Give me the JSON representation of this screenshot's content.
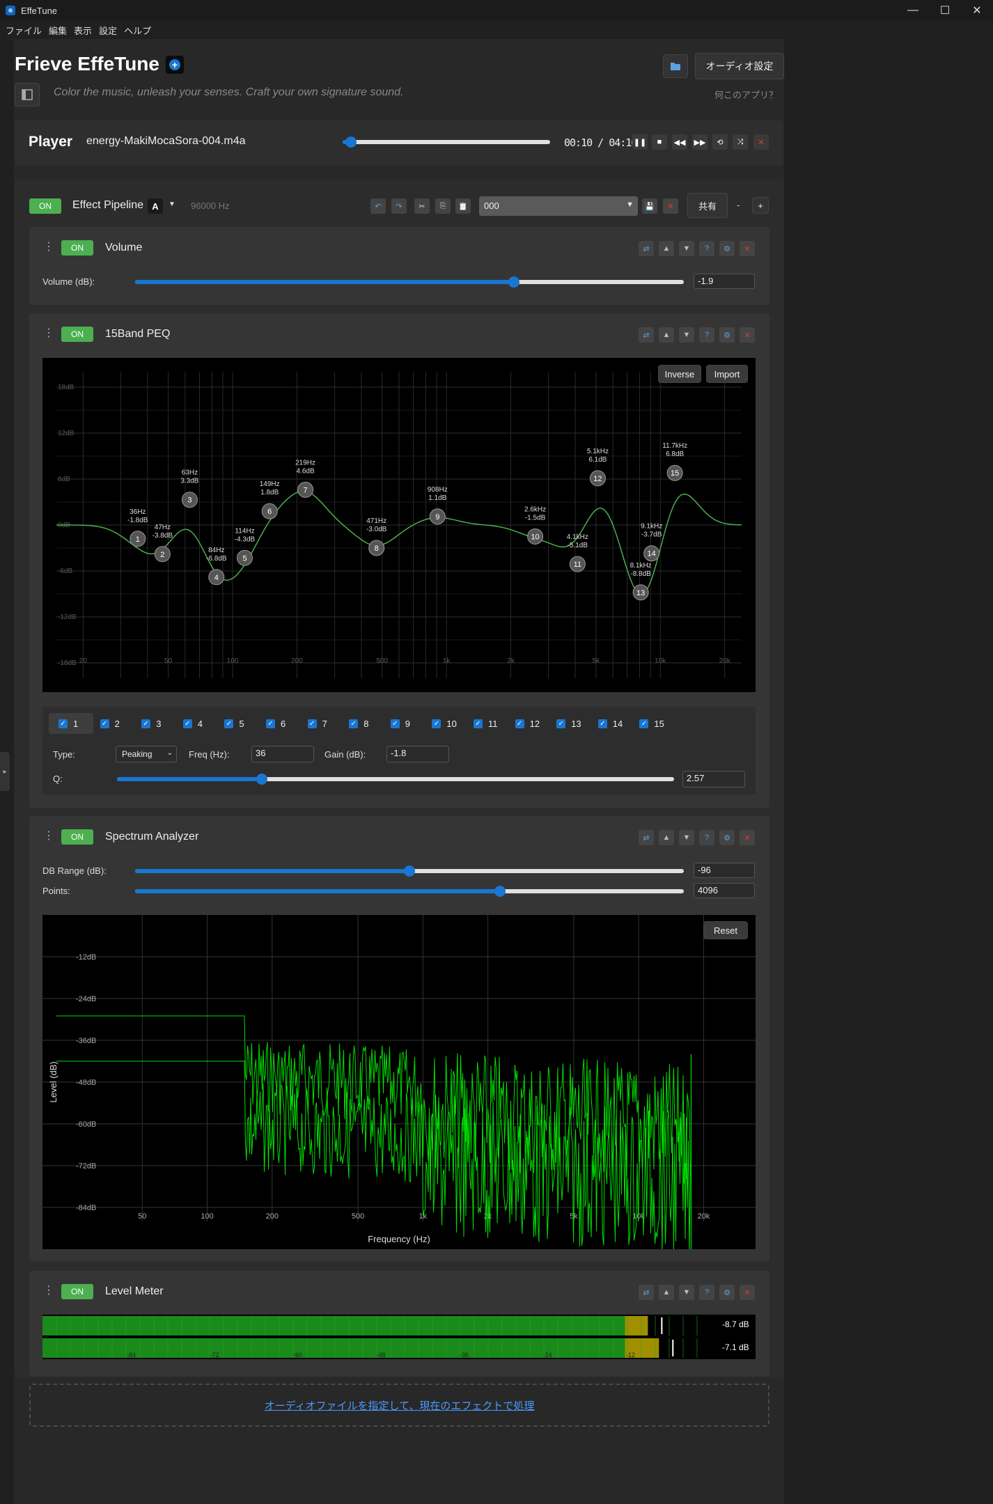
{
  "window": {
    "title": "EffeTune"
  },
  "menu": [
    "ファイル",
    "編集",
    "表示",
    "設定",
    "ヘルプ"
  ],
  "header": {
    "title": "Frieve EffeTune",
    "subtitle": "Color the music, unleash your senses. Craft your own signature sound.",
    "audio_settings": "オーディオ設定",
    "what_is_app": "何このアプリ？"
  },
  "player": {
    "label": "Player",
    "file": "energy-MakiMocaSora-004.m4a",
    "time": "00:10 / 04:10",
    "progress": 0.04
  },
  "pipeline": {
    "on_label": "ON",
    "title": "Effect Pipeline",
    "ab": "A",
    "rate": "96000 Hz",
    "preset": "000",
    "share": "共有",
    "minus": "-",
    "plus": "+"
  },
  "volume": {
    "on_label": "ON",
    "name": "Volume",
    "param_label": "Volume (dB):",
    "value": "-1.9",
    "position": 0.69
  },
  "peq": {
    "on_label": "ON",
    "name": "15Band PEQ",
    "inverse": "Inverse",
    "import": "Import",
    "y_ticks": [
      "18dB",
      "12dB",
      "6dB",
      "0dB",
      "-6dB",
      "-12dB",
      "-18dB"
    ],
    "x_ticks": [
      "20",
      "50",
      "100",
      "200",
      "500",
      "1k",
      "2k",
      "5k",
      "10k",
      "20k"
    ],
    "bands": [
      {
        "n": "1",
        "freq": "36Hz",
        "gain": "-1.8dB"
      },
      {
        "n": "2",
        "freq": "47Hz",
        "gain": "-3.8dB"
      },
      {
        "n": "3",
        "freq": "63Hz",
        "gain": "3.3dB"
      },
      {
        "n": "4",
        "freq": "84Hz",
        "gain": "-6.8dB"
      },
      {
        "n": "5",
        "freq": "114Hz",
        "gain": "-4.3dB"
      },
      {
        "n": "6",
        "freq": "149Hz",
        "gain": "1.8dB"
      },
      {
        "n": "7",
        "freq": "219Hz",
        "gain": "4.6dB"
      },
      {
        "n": "8",
        "freq": "471Hz",
        "gain": "-3.0dB"
      },
      {
        "n": "9",
        "freq": "908Hz",
        "gain": "1.1dB"
      },
      {
        "n": "10",
        "freq": "2.6kHz",
        "gain": "-1.5dB"
      },
      {
        "n": "11",
        "freq": "4.1kHz",
        "gain": "-5.1dB"
      },
      {
        "n": "12",
        "freq": "5.1kHz",
        "gain": "6.1dB"
      },
      {
        "n": "13",
        "freq": "8.1kHz",
        "gain": "-8.8dB"
      },
      {
        "n": "14",
        "freq": "9.1kHz",
        "gain": "-3.7dB"
      },
      {
        "n": "15",
        "freq": "11.7kHz",
        "gain": "6.8dB"
      }
    ],
    "type_label": "Type:",
    "type_value": "Peaking",
    "freq_label": "Freq (Hz):",
    "freq_value": "36",
    "gain_label": "Gain (dB):",
    "gain_value": "-1.8",
    "q_label": "Q:",
    "q_value": "2.57",
    "q_position": 0.26
  },
  "spectrum": {
    "on_label": "ON",
    "name": "Spectrum Analyzer",
    "range_label": "DB Range (dB):",
    "range_value": "-96",
    "range_position": 0.5,
    "points_label": "Points:",
    "points_value": "4096",
    "points_position": 0.665,
    "reset": "Reset",
    "y_ticks": [
      "-12dB",
      "-24dB",
      "-36dB",
      "-48dB",
      "-60dB",
      "-72dB",
      "-84dB"
    ],
    "x_ticks": [
      "50",
      "100",
      "200",
      "500",
      "1k",
      "2k",
      "5k",
      "10k",
      "20k"
    ],
    "ylabel": "Level (dB)",
    "xlabel": "Frequency (Hz)"
  },
  "level": {
    "on_label": "ON",
    "name": "Level Meter",
    "scale": [
      "-84",
      "-72",
      "-60",
      "-48",
      "-36",
      "-24",
      "-12"
    ],
    "ch1": "-8.7 dB",
    "ch2": "-7.1 dB"
  },
  "process_link": "オーディオファイルを指定して、現在のエフェクトで処理",
  "colors": {
    "accent": "#1976d2",
    "on": "#4caf50",
    "curve": "#4caf50",
    "spectrum": "#00e000"
  }
}
